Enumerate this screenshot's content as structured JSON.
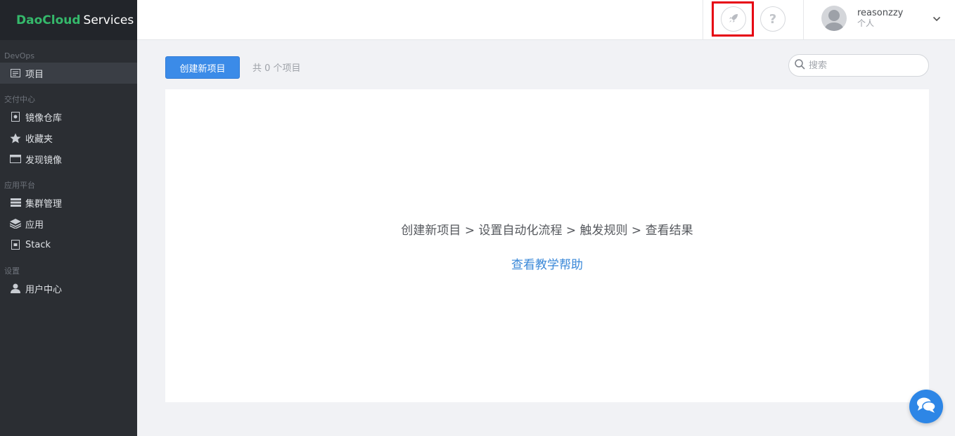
{
  "brand": {
    "part1": "DaoCloud",
    "part2": "Services",
    "color": "#35b96b"
  },
  "sidebar": {
    "groups": [
      {
        "label": "DevOps",
        "items": [
          {
            "label": "项目",
            "icon": "project-icon",
            "active": true
          }
        ]
      },
      {
        "label": "交付中心",
        "items": [
          {
            "label": "镜像仓库",
            "icon": "image-registry-icon"
          },
          {
            "label": "收藏夹",
            "icon": "star-icon"
          },
          {
            "label": "发现镜像",
            "icon": "discover-icon"
          }
        ]
      },
      {
        "label": "应用平台",
        "items": [
          {
            "label": "集群管理",
            "icon": "cluster-icon"
          },
          {
            "label": "应用",
            "icon": "layers-icon"
          },
          {
            "label": "Stack",
            "icon": "stack-icon"
          }
        ]
      },
      {
        "label": "设置",
        "items": [
          {
            "label": "用户中心",
            "icon": "user-icon"
          }
        ]
      }
    ]
  },
  "header": {
    "help_label": "?",
    "user": {
      "name": "reasonzzy",
      "type": "个人"
    }
  },
  "toolbar": {
    "create_label": "创建新项目",
    "count_text": "共 0 个项目",
    "search_placeholder": "搜索"
  },
  "main": {
    "steps_text": "创建新项目 > 设置自动化流程 > 触发规则 > 查看结果",
    "tutorial_link": "查看教学帮助"
  },
  "colors": {
    "primary": "#3b8be8",
    "highlight": "#e60012",
    "sidebar_bg": "#2b2e33"
  }
}
